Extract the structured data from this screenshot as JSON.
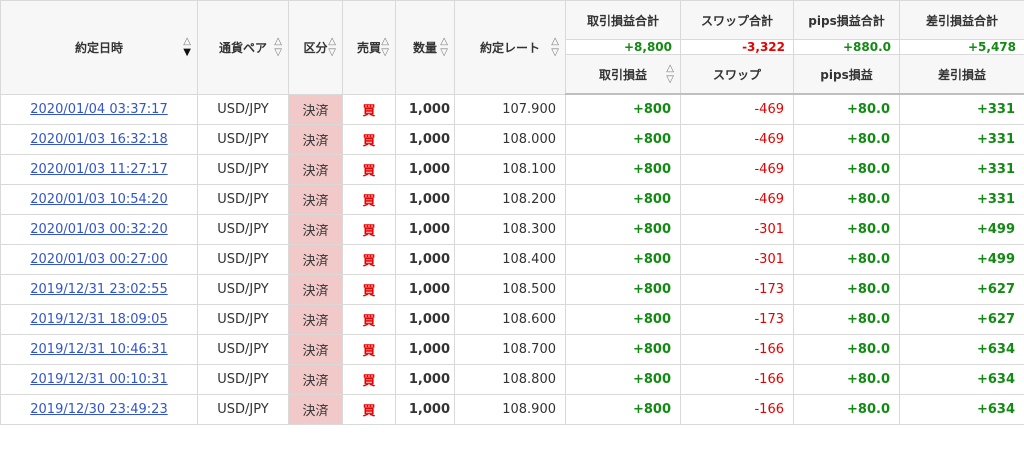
{
  "headers": {
    "datetime": "約定日時",
    "pair": "通貨ペア",
    "kubun": "区分",
    "side": "売買",
    "qty": "数量",
    "rate": "約定レート",
    "profit": "取引損益",
    "swap": "スワップ",
    "pips": "pips損益",
    "net": "差引損益"
  },
  "summary": {
    "profit_label": "取引損益合計",
    "swap_label": "スワップ合計",
    "pips_label": "pips損益合計",
    "net_label": "差引損益合計",
    "profit_total": "+8,800",
    "swap_total": "-3,322",
    "pips_total": "+880.0",
    "net_total": "+5,478"
  },
  "sort": {
    "up": "△",
    "down_active": "▼",
    "down": "▽"
  },
  "colors": {
    "positive": "#138a13",
    "negative": "#e60000",
    "kubun_bg": "#f2c9c9",
    "link": "#3355cc"
  },
  "rows": [
    {
      "datetime": "2020/01/04 03:37:17",
      "pair": "USD/JPY",
      "kubun": "決済",
      "side": "買",
      "qty": "1,000",
      "rate": "107.900",
      "profit": "+800",
      "swap": "-469",
      "pips": "+80.0",
      "net": "+331"
    },
    {
      "datetime": "2020/01/03 16:32:18",
      "pair": "USD/JPY",
      "kubun": "決済",
      "side": "買",
      "qty": "1,000",
      "rate": "108.000",
      "profit": "+800",
      "swap": "-469",
      "pips": "+80.0",
      "net": "+331"
    },
    {
      "datetime": "2020/01/03 11:27:17",
      "pair": "USD/JPY",
      "kubun": "決済",
      "side": "買",
      "qty": "1,000",
      "rate": "108.100",
      "profit": "+800",
      "swap": "-469",
      "pips": "+80.0",
      "net": "+331"
    },
    {
      "datetime": "2020/01/03 10:54:20",
      "pair": "USD/JPY",
      "kubun": "決済",
      "side": "買",
      "qty": "1,000",
      "rate": "108.200",
      "profit": "+800",
      "swap": "-469",
      "pips": "+80.0",
      "net": "+331"
    },
    {
      "datetime": "2020/01/03 00:32:20",
      "pair": "USD/JPY",
      "kubun": "決済",
      "side": "買",
      "qty": "1,000",
      "rate": "108.300",
      "profit": "+800",
      "swap": "-301",
      "pips": "+80.0",
      "net": "+499"
    },
    {
      "datetime": "2020/01/03 00:27:00",
      "pair": "USD/JPY",
      "kubun": "決済",
      "side": "買",
      "qty": "1,000",
      "rate": "108.400",
      "profit": "+800",
      "swap": "-301",
      "pips": "+80.0",
      "net": "+499"
    },
    {
      "datetime": "2019/12/31 23:02:55",
      "pair": "USD/JPY",
      "kubun": "決済",
      "side": "買",
      "qty": "1,000",
      "rate": "108.500",
      "profit": "+800",
      "swap": "-173",
      "pips": "+80.0",
      "net": "+627"
    },
    {
      "datetime": "2019/12/31 18:09:05",
      "pair": "USD/JPY",
      "kubun": "決済",
      "side": "買",
      "qty": "1,000",
      "rate": "108.600",
      "profit": "+800",
      "swap": "-173",
      "pips": "+80.0",
      "net": "+627"
    },
    {
      "datetime": "2019/12/31 10:46:31",
      "pair": "USD/JPY",
      "kubun": "決済",
      "side": "買",
      "qty": "1,000",
      "rate": "108.700",
      "profit": "+800",
      "swap": "-166",
      "pips": "+80.0",
      "net": "+634"
    },
    {
      "datetime": "2019/12/31 00:10:31",
      "pair": "USD/JPY",
      "kubun": "決済",
      "side": "買",
      "qty": "1,000",
      "rate": "108.800",
      "profit": "+800",
      "swap": "-166",
      "pips": "+80.0",
      "net": "+634"
    },
    {
      "datetime": "2019/12/30 23:49:23",
      "pair": "USD/JPY",
      "kubun": "決済",
      "side": "買",
      "qty": "1,000",
      "rate": "108.900",
      "profit": "+800",
      "swap": "-166",
      "pips": "+80.0",
      "net": "+634"
    }
  ]
}
